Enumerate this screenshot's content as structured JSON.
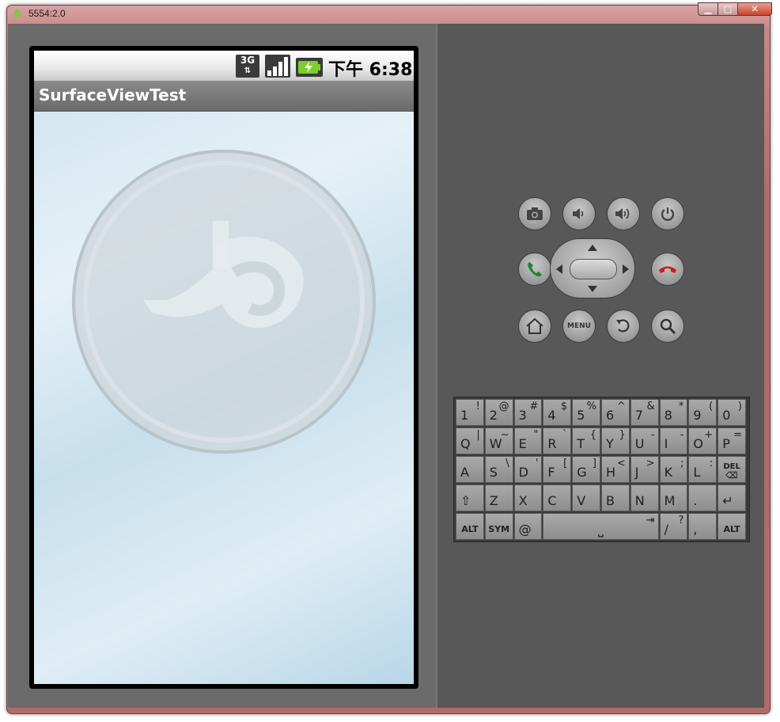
{
  "window": {
    "title": "5554:2.0"
  },
  "statusbar": {
    "network": "3G",
    "time": "下午 6:38"
  },
  "app": {
    "title": "SurfaceViewTest"
  },
  "controls": {
    "menu_label": "MENU"
  },
  "keyboard": {
    "rows": [
      [
        {
          "m": "1",
          "a": "!"
        },
        {
          "m": "2",
          "a": "@"
        },
        {
          "m": "3",
          "a": "#"
        },
        {
          "m": "4",
          "a": "$"
        },
        {
          "m": "5",
          "a": "%"
        },
        {
          "m": "6",
          "a": "^"
        },
        {
          "m": "7",
          "a": "&"
        },
        {
          "m": "8",
          "a": "*"
        },
        {
          "m": "9",
          "a": "("
        },
        {
          "m": "0",
          "a": ")"
        }
      ],
      [
        {
          "m": "Q",
          "a": "|"
        },
        {
          "m": "W",
          "a": "~"
        },
        {
          "m": "E",
          "a": "\""
        },
        {
          "m": "R",
          "a": "`"
        },
        {
          "m": "T",
          "a": "{"
        },
        {
          "m": "Y",
          "a": "}"
        },
        {
          "m": "U",
          "a": "-"
        },
        {
          "m": "I",
          "a": "-"
        },
        {
          "m": "O",
          "a": "+"
        },
        {
          "m": "P",
          "a": "="
        }
      ],
      [
        {
          "m": "A",
          "a": ""
        },
        {
          "m": "S",
          "a": "\\"
        },
        {
          "m": "D",
          "a": "'"
        },
        {
          "m": "F",
          "a": "["
        },
        {
          "m": "G",
          "a": "]"
        },
        {
          "m": "H",
          "a": "<"
        },
        {
          "m": "J",
          "a": ">"
        },
        {
          "m": "K",
          "a": ";"
        },
        {
          "m": "L",
          "a": ":"
        },
        {
          "m": "DEL",
          "a": ""
        }
      ],
      [
        {
          "m": "⇧",
          "a": ""
        },
        {
          "m": "Z",
          "a": ""
        },
        {
          "m": "X",
          "a": ""
        },
        {
          "m": "C",
          "a": ""
        },
        {
          "m": "V",
          "a": ""
        },
        {
          "m": "B",
          "a": ""
        },
        {
          "m": "N",
          "a": ""
        },
        {
          "m": "M",
          "a": ""
        },
        {
          "m": ".",
          "a": ""
        },
        {
          "m": "↵",
          "a": ""
        }
      ]
    ],
    "bottom": {
      "alt_left": "ALT",
      "sym": "SYM",
      "at": "@",
      "slash": "/",
      "slash_alt": "?",
      "comma": ",",
      "alt_right": "ALT"
    }
  }
}
